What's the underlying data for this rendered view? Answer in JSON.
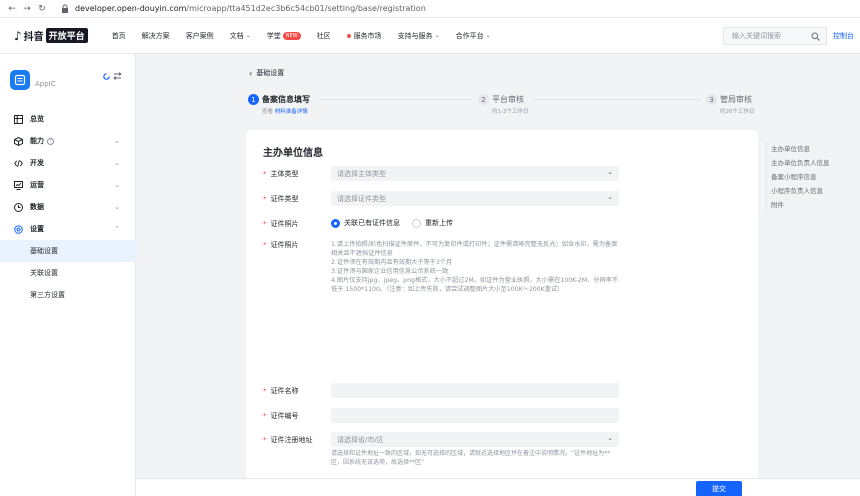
{
  "browser": {
    "url_domain": "developer.open-douyin.com",
    "url_path": "/microapp/tta451d2ec3b6c54cb01/setting/base/registration"
  },
  "topnav": {
    "logo_brand": "抖音",
    "logo_badge": "开放平台",
    "items": [
      {
        "label": "首页"
      },
      {
        "label": "解决方案"
      },
      {
        "label": "客户案例"
      },
      {
        "label": "文档"
      },
      {
        "label": "学堂",
        "badge": "NEW"
      },
      {
        "label": "社区"
      },
      {
        "label": "服务市场"
      },
      {
        "label": "支持与服务"
      },
      {
        "label": "合作平台"
      }
    ],
    "search_placeholder": "输入关键词搜索",
    "console_link": "控制台"
  },
  "sidebar": {
    "app_name": "AppIC",
    "menu": [
      {
        "label": "总览"
      },
      {
        "label": "能力"
      },
      {
        "label": "开发"
      },
      {
        "label": "运营"
      },
      {
        "label": "数据"
      },
      {
        "label": "设置"
      }
    ],
    "submenu": [
      {
        "label": "基础设置"
      },
      {
        "label": "关联设置"
      },
      {
        "label": "第三方设置"
      }
    ]
  },
  "content": {
    "back_label": "基础设置",
    "steps": [
      {
        "num": "1",
        "title": "备案信息填写",
        "desc_prefix": "查看 ",
        "desc_link": "材料准备详情"
      },
      {
        "num": "2",
        "title": "平台审核",
        "desc": "约1-3个工作日"
      },
      {
        "num": "3",
        "title": "管局审核",
        "desc": "约20个工作日"
      }
    ],
    "form": {
      "title": "主办单位信息",
      "subject_type": {
        "label": "主体类型",
        "placeholder": "请选择主体类型"
      },
      "cert_type": {
        "label": "证件类型",
        "placeholder": "请选择证件类型"
      },
      "cert_photo_radio": {
        "label": "证件照片",
        "option1": "关联已有证件信息",
        "option2": "重新上传"
      },
      "cert_photo": {
        "label": "证件照片",
        "notes": [
          "1.请上传拍照/彩色扫描证件原件，不可为复印件或打印件；证件需清晰完整无反光；如含水印，需为备案相关且不遮挡证件信息",
          "2.证件须在有效期内且有效期大于等于3个月",
          "3.证件须与国家企业信用信息公示系统一致",
          "4.图片仅支持jpg、jpeg、png格式，大小不超过2M。如证件为营业执照，大小需在100K-2M、分辨率不低于 1500*1100。（注意：如上传失败，请尝试调整图片大小至100K～200K重试）"
        ]
      },
      "cert_name": {
        "label": "证件名称"
      },
      "cert_number": {
        "label": "证件编号"
      },
      "cert_address": {
        "label": "证件注册地址",
        "placeholder": "请选择省/市/区",
        "tip": "请选择和证件地址一致的区域，如无可选择的区域，请就近选择地区并在备注中说明情况。“证件地址为**区，因系统无该选项，故选择**区”"
      }
    },
    "anchor": [
      "主办单位信息",
      "主办单位负责人信息",
      "备案小程序信息",
      "小程序负责人信息",
      "附件"
    ],
    "submit_label": "提交"
  }
}
